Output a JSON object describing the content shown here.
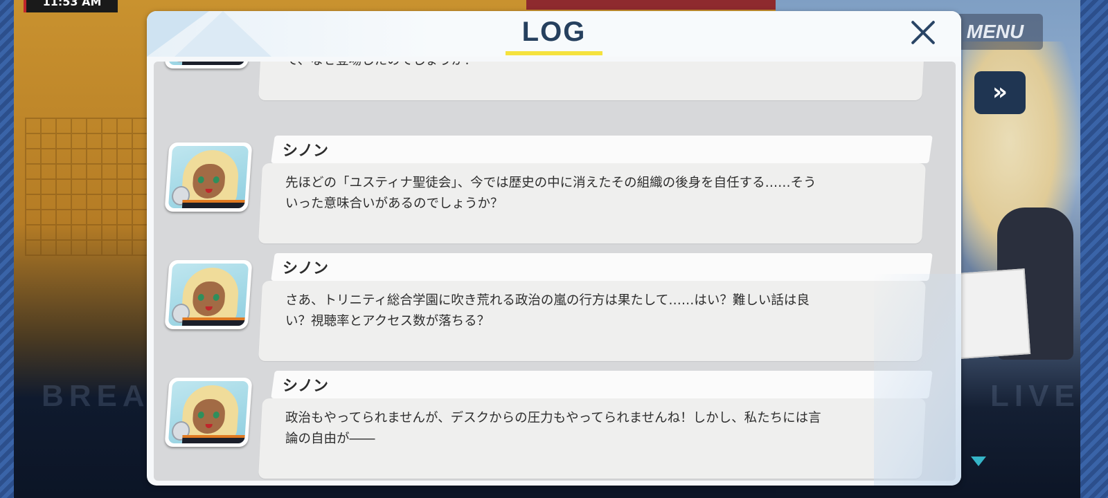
{
  "hud": {
    "time": "11:53 AM",
    "menu_label": "MENU",
    "skip_label": "»",
    "bg_text_left": "BREA",
    "bg_text_right": "LIVE"
  },
  "log": {
    "title": "LOG",
    "close_label": "×",
    "entries": [
      {
        "speaker": "",
        "message": "これまで長い間、対外的な活動を自ら禁じていた「シスターフッド」……彼女たちがここに来\nて、なぜ登場したのでしょうか？"
      },
      {
        "speaker": "シノン",
        "message": "先ほどの「ユスティナ聖徒会」、今では歴史の中に消えたその組織の後身を自任する……そう\nいった意味合いがあるのでしょうか？"
      },
      {
        "speaker": "シノン",
        "message": "さあ、トリニティ総合学園に吹き荒れる政治の嵐の行方は果たして……はい？難しい話は良\nい？視聴率とアクセス数が落ちる？"
      },
      {
        "speaker": "シノン",
        "message": "政治もやってられませんが、デスクからの圧力もやってられませんね！しかし、私たちには言\n論の自由が――"
      }
    ]
  },
  "colors": {
    "accent_underline": "#f5e23d",
    "title_color": "#26405e",
    "next_arrow": "#35b5c8"
  }
}
